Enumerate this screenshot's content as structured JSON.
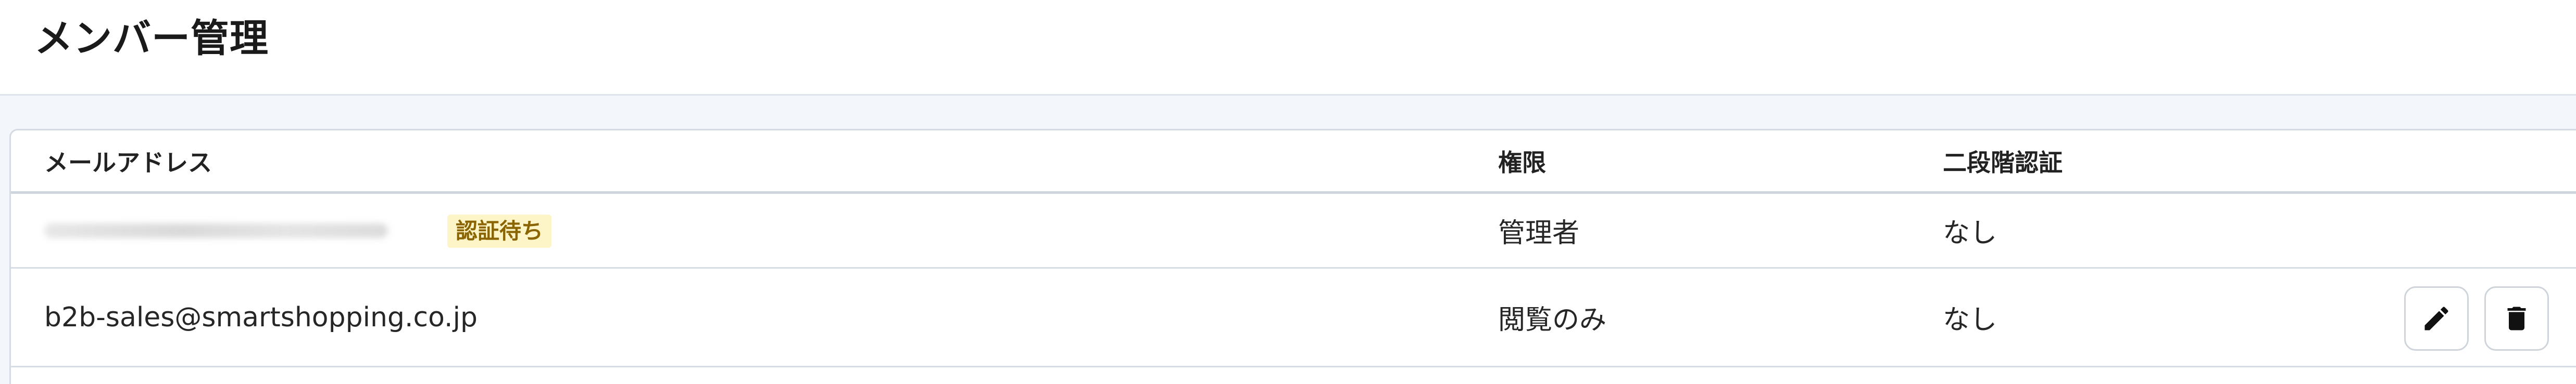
{
  "page": {
    "title": "メンバー管理"
  },
  "table": {
    "columns": [
      "メールアドレス",
      "権限",
      "二段階認証"
    ],
    "rows": [
      {
        "email": "",
        "badge": "認証待ち",
        "role": "管理者",
        "mfa": "なし"
      },
      {
        "email": "b2b-sales@smartshopping.co.jp",
        "role": "閲覧のみ",
        "mfa": "なし"
      }
    ]
  },
  "icons": {
    "edit": "pencil-icon",
    "delete": "trash-icon"
  }
}
